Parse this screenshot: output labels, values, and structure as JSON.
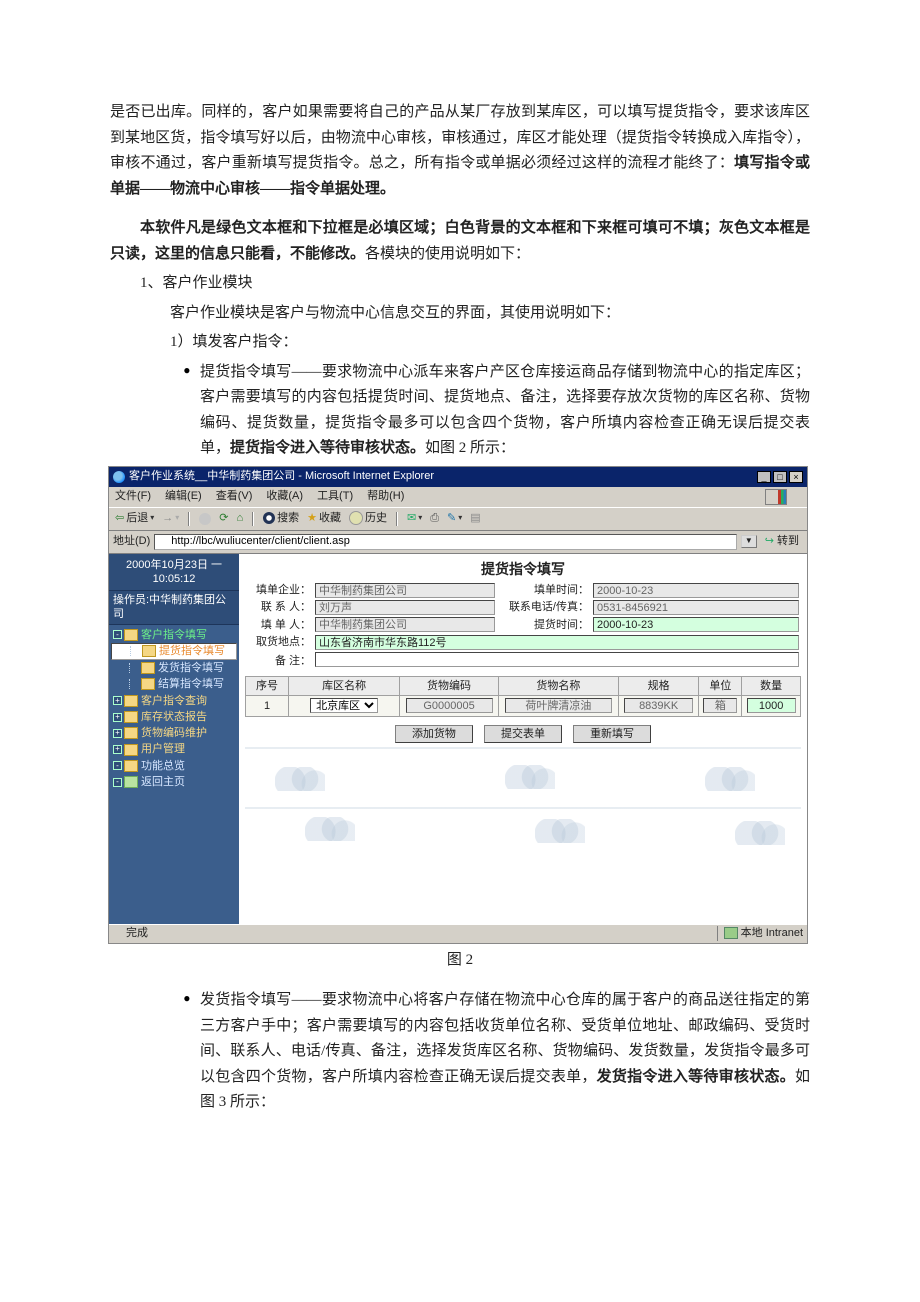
{
  "doc": {
    "p1": "是否已出库。同样的，客户如果需要将自己的产品从某厂存放到某库区，可以填写提货指令，要求该库区到某地区货，指令填写好以后，由物流中心审核，审核通过，库区才能处理（提货指令转换成入库指令），审核不通过，客户重新填写提货指令。总之，所有指令或单据必须经过这样的流程才能终了：",
    "p1_bold": "填写指令或单据——物流中心审核——指令单据处理。",
    "p2_bold": "本软件凡是绿色文本框和下拉框是必填区域；白色背景的文本框和下来框可填可不填；灰色文本框是只读，这里的信息只能看，不能修改。",
    "p2_tail": "各模块的使用说明如下：",
    "m1_title": "1、客户作业模块",
    "m1_desc": "客户作业模块是客户与物流中心信息交互的界面，其使用说明如下：",
    "m1_1": "1）填发客户指令：",
    "b1_lead": "提货指令填写——",
    "b1_body": "要求物流中心派车来客户产区仓库接运商品存储到物流中心的指定库区；客户需要填写的内容包括提货时间、提货地点、备注，选择要存放次货物的库区名称、货物编码、提货数量，提货指令最多可以包含四个货物，客户所填内容检查正确无误后提交表单，",
    "b1_bold": "提货指令进入等待审核状态。",
    "b1_tail": "如图 2 所示：",
    "caption": "图 2",
    "b2_lead": "发货指令填写——",
    "b2_body": "要求物流中心将客户存储在物流中心仓库的属于客户的商品送往指定的第三方客户手中；客户需要填写的内容包括收货单位名称、受货单位地址、邮政编码、受货时间、联系人、电话/传真、备注，选择发货库区名称、货物编码、发货数量，发货指令最多可以包含四个货物，客户所填内容检查正确无误后提交表单，",
    "b2_bold": "发货指令进入等待审核状态。",
    "b2_tail": "如图 3 所示："
  },
  "app": {
    "title": "客户作业系统__中华制药集团公司 - Microsoft Internet Explorer",
    "menus": {
      "file": "文件(F)",
      "edit": "编辑(E)",
      "view": "查看(V)",
      "fav": "收藏(A)",
      "tools": "工具(T)",
      "help": "帮助(H)"
    },
    "toolbar": {
      "back": "后退",
      "search": "搜索",
      "fav": "收藏",
      "history": "历史"
    },
    "address": {
      "label": "地址(D)",
      "url": "http://lbc/wuliucenter/client/client.asp",
      "go": "转到"
    },
    "sidebar": {
      "dateLine1": "2000年10月23日  一",
      "dateLine2": "10:05:12",
      "operator": "操作员:中华制药集团公司",
      "nodes": [
        {
          "label": "客户指令填写",
          "depth": 1,
          "exp": "-",
          "cls": "green"
        },
        {
          "label": "提货指令填写",
          "depth": 2,
          "cls": "sel"
        },
        {
          "label": "发货指令填写",
          "depth": 2,
          "cls": ""
        },
        {
          "label": "结算指令填写",
          "depth": 2,
          "cls": ""
        },
        {
          "label": "客户指令查询",
          "depth": 1,
          "exp": "+",
          "cls": "yellow"
        },
        {
          "label": "库存状态报告",
          "depth": 1,
          "exp": "+",
          "cls": "yellow"
        },
        {
          "label": "货物编码维护",
          "depth": 1,
          "exp": "+",
          "cls": "yellow"
        },
        {
          "label": "用户管理",
          "depth": 1,
          "exp": "+",
          "cls": "yellow"
        },
        {
          "label": "功能总览",
          "depth": 1,
          "exp": "-",
          "cls": ""
        },
        {
          "label": "返回主页",
          "depth": 1,
          "exp": "-",
          "cls": "back"
        }
      ]
    },
    "main": {
      "title": "提货指令填写",
      "labels": {
        "company": "填单企业：",
        "fillTime": "填单时间：",
        "contact": "联 系 人：",
        "phone": "联系电话/传真：",
        "fillPerson": "填 单 人：",
        "pickTime": "提货时间：",
        "pickAddr": "取货地点：",
        "remark": "备    注："
      },
      "values": {
        "company": "中华制药集团公司",
        "fillTime": "2000-10-23",
        "contact": "刘万声",
        "phone": "0531-8456921",
        "fillPerson": "中华制药集团公司",
        "pickTime": "2000-10-23",
        "pickAddr": "山东省济南市华东路112号",
        "remark": ""
      },
      "grid": {
        "headers": [
          "序号",
          "库区名称",
          "货物编码",
          "货物名称",
          "规格",
          "单位",
          "数量"
        ],
        "rows": [
          {
            "no": "1",
            "area": "北京库区",
            "code": "G0000005",
            "name": "荷叶牌清凉油",
            "spec": "8839KK",
            "unit": "箱",
            "qty": "1000"
          }
        ]
      },
      "buttons": {
        "add": "添加货物",
        "submit": "提交表单",
        "reset": "重新填写"
      }
    },
    "status": {
      "done": "完成",
      "zone": "本地 Intranet"
    }
  }
}
